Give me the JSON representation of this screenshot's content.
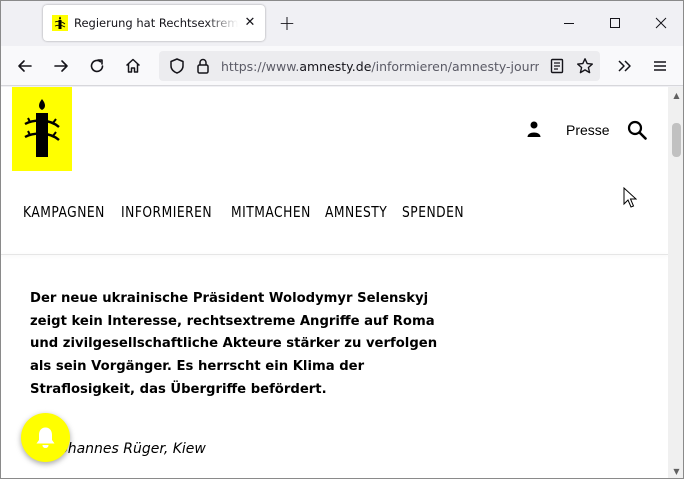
{
  "browser": {
    "tab_title": "Regierung hat Rechtsextreme nicht im Griff",
    "url_prefix": "https://www.",
    "url_host": "amnesty.de",
    "url_path": "/informieren/amnesty-journal/",
    "tab_close": "✕",
    "new_tab": "+"
  },
  "header": {
    "presse_label": "Presse",
    "nav": [
      "KAMPAGNEN",
      "INFORMIEREN",
      "MITMACHEN",
      "AMNESTY",
      "SPENDEN"
    ]
  },
  "article": {
    "lead": "Der neue ukrainische Präsident Wolodymyr Selenskyj zeigt kein Interesse, rechtsextreme Angriffe auf Roma und zivilgesellschaftliche Akteure stärker zu verfolgen als sein Vorgänger. Es herrscht ein Klima der Straflosigkeit, das Übergriffe befördert.",
    "byline": "Johannes Rüger, Kiew"
  },
  "colors": {
    "brand_yellow": "#ffff00",
    "text": "#000000"
  },
  "icons": [
    "candle-logo-icon",
    "user-icon",
    "search-icon",
    "bell-icon",
    "back-icon",
    "forward-icon",
    "reload-icon",
    "home-icon",
    "shield-icon",
    "lock-icon",
    "reader-icon",
    "star-icon",
    "overflow-icon",
    "menu-icon"
  ]
}
